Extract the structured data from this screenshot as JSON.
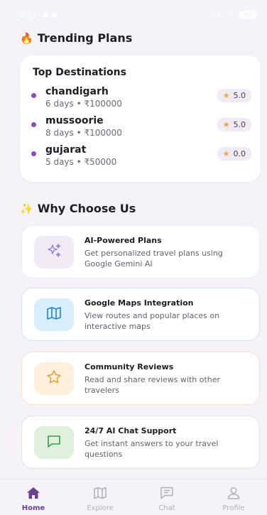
{
  "status_bar": {
    "time": "8:51",
    "notifications": "● ●",
    "battery": "46"
  },
  "trending": {
    "emoji": "🔥",
    "title": "Trending Plans",
    "card_title": "Top Destinations",
    "destinations": [
      {
        "name": "chandigarh",
        "meta": "6 days • ₹100000",
        "rating": "5.0"
      },
      {
        "name": "mussoorie",
        "meta": "8 days • ₹100000",
        "rating": "5.0"
      },
      {
        "name": "gujarat",
        "meta": "5 days • ₹50000",
        "rating": "0.0"
      }
    ]
  },
  "why": {
    "emoji": "✨",
    "title": "Why Choose Us",
    "features": [
      {
        "title": "AI-Powered Plans",
        "desc": "Get personalized travel plans using Google Gemini AI",
        "icon": "sparkles-icon",
        "color": "#9b7bd0"
      },
      {
        "title": "Google Maps Integration",
        "desc": "View routes and popular places on interactive maps",
        "icon": "map-icon",
        "color": "#1f86d6"
      },
      {
        "title": "Community Reviews",
        "desc": "Read and share reviews with other travelers",
        "icon": "star-icon",
        "color": "#e8a23a"
      },
      {
        "title": "24/7 AI Chat Support",
        "desc": "Get instant answers to your travel questions",
        "icon": "chat-icon",
        "color": "#3f9a4a"
      }
    ]
  },
  "nav": {
    "items": [
      {
        "label": "Home",
        "icon": "home-icon",
        "active": true
      },
      {
        "label": "Explore",
        "icon": "map-icon",
        "active": false
      },
      {
        "label": "Chat",
        "icon": "chat-icon",
        "active": false
      },
      {
        "label": "Profile",
        "icon": "profile-icon",
        "active": false
      }
    ],
    "active_color": "#6b3f8f",
    "inactive_color": "#b3aeb9"
  }
}
